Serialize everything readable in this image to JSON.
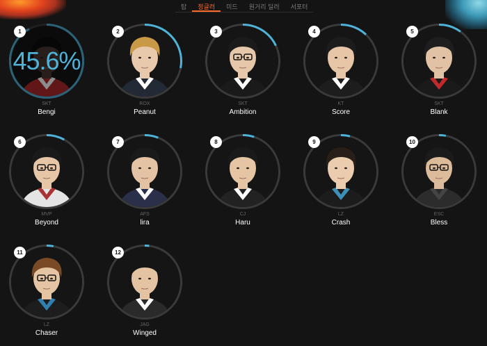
{
  "tabs": [
    {
      "label": "탑",
      "active": false
    },
    {
      "label": "정글러",
      "active": true
    },
    {
      "label": "미드",
      "active": false
    },
    {
      "label": "원거리 딜러",
      "active": false
    },
    {
      "label": "서포터",
      "active": false
    }
  ],
  "players": [
    {
      "rank": "1",
      "team": "SKT",
      "name": "Bengi",
      "percent": "45.6%",
      "selected": true,
      "skin": "#4a3a33",
      "hair": "#0e0e0e",
      "shirt": "#b12a2a",
      "collar": "#ffffff"
    },
    {
      "rank": "2",
      "team": "ROX",
      "name": "Peanut",
      "skin": "#e9c9ac",
      "hair": "#c89a47",
      "shirt": "#222a36",
      "collar": "#ffffff"
    },
    {
      "rank": "3",
      "team": "SKT",
      "name": "Ambition",
      "skin": "#e6c7aa",
      "hair": "#1b1b1b",
      "shirt": "#1a1a1a",
      "collar": "#ffffff",
      "glasses": true
    },
    {
      "rank": "4",
      "team": "KT",
      "name": "Score",
      "skin": "#e7c6a7",
      "hair": "#1c1c1c",
      "shirt": "#1d1d1d",
      "collar": "#ffffff"
    },
    {
      "rank": "5",
      "team": "SKT",
      "name": "Blank",
      "skin": "#e2c2a4",
      "hair": "#1e1e1e",
      "shirt": "#1a1a1a",
      "collar": "#c12a2a"
    },
    {
      "rank": "6",
      "team": "MVP",
      "name": "Beyond",
      "skin": "#e6c6a6",
      "hair": "#1a1a1a",
      "shirt": "#e4e4e4",
      "collar": "#a83333",
      "glasses": true
    },
    {
      "rank": "7",
      "team": "AFS",
      "name": "lira",
      "skin": "#e3c3a3",
      "hair": "#1a1a1a",
      "shirt": "#2a2f4a",
      "collar": "#ffffff"
    },
    {
      "rank": "8",
      "team": "CJ",
      "name": "Haru",
      "skin": "#e6c5a5",
      "hair": "#1a1a1a",
      "shirt": "#222222",
      "collar": "#ffffff"
    },
    {
      "rank": "9",
      "team": "LZ",
      "name": "Crash",
      "skin": "#ecccaf",
      "hair": "#2a1f18",
      "shirt": "#1c1c1c",
      "collar": "#3d8fb8"
    },
    {
      "rank": "10",
      "team": "ESC",
      "name": "Bless",
      "skin": "#dcbb9b",
      "hair": "#1b1b1b",
      "shirt": "#2c2c2c",
      "collar": "#444444",
      "glasses": true
    },
    {
      "rank": "11",
      "team": "LZ",
      "name": "Chaser",
      "skin": "#e5c4a3",
      "hair": "#7a4a26",
      "shirt": "#1d1d1d",
      "collar": "#2f7fb0",
      "glasses": true
    },
    {
      "rank": "12",
      "team": "JAG",
      "name": "Winged",
      "skin": "#e4c3a3",
      "hair": "#151515",
      "shirt": "#2a2a2a",
      "collar": "#ffffff"
    }
  ],
  "accent": "#ff6a2b",
  "ring_highlight": "#4fb3d9"
}
